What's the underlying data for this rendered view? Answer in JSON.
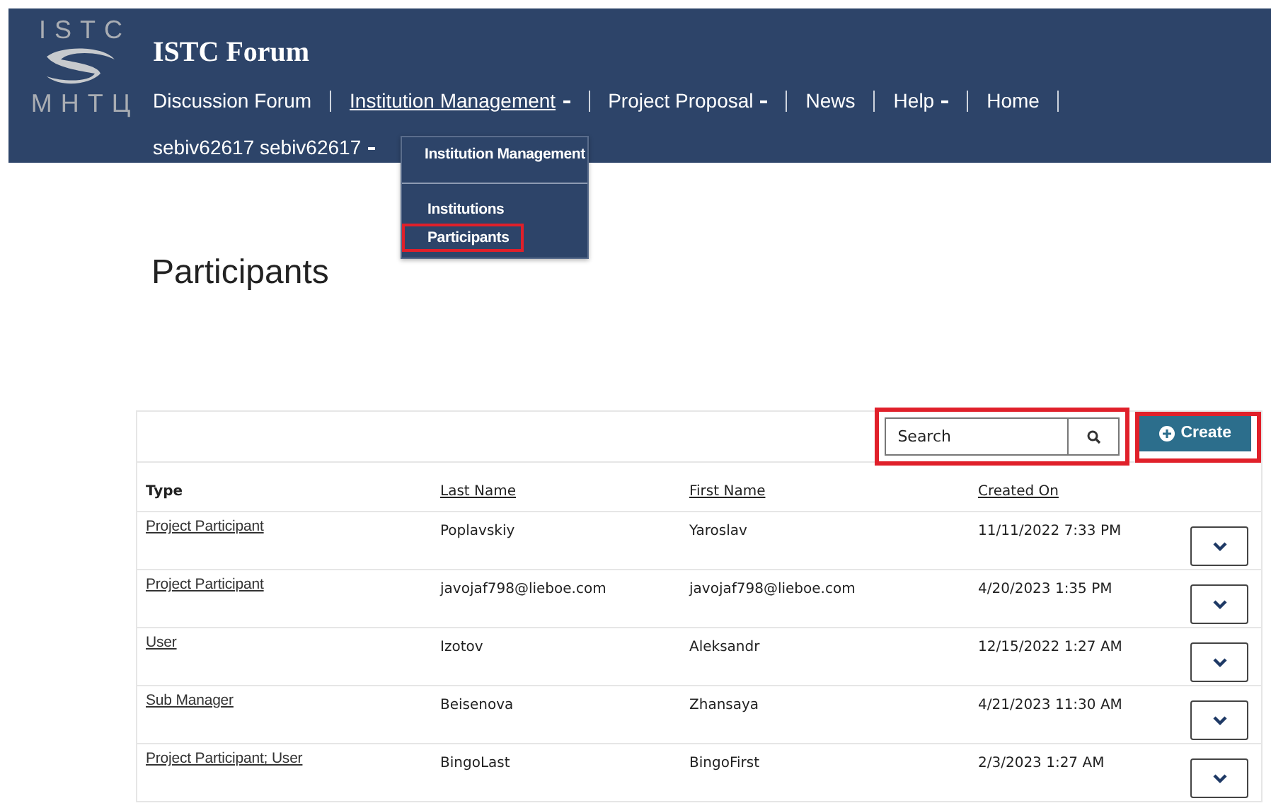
{
  "logo": {
    "top": "ISTC",
    "bottom": "МНТЦ"
  },
  "site_title": "ISTC Forum",
  "nav": [
    {
      "label": "Discussion Forum",
      "caret": false,
      "active": false
    },
    {
      "label": "Institution Management",
      "caret": true,
      "active": true
    },
    {
      "label": "Project Proposal",
      "caret": true,
      "active": false
    },
    {
      "label": "News",
      "caret": false,
      "active": false
    },
    {
      "label": "Help",
      "caret": true,
      "active": false
    },
    {
      "label": "Home",
      "caret": false,
      "active": false
    }
  ],
  "user_menu": {
    "label": "sebiv62617 sebiv62617",
    "caret": true
  },
  "dropdown": {
    "heading": "Institution Management",
    "items": [
      {
        "label": "Institutions",
        "highlighted": false
      },
      {
        "label": "Participants",
        "highlighted": true
      }
    ]
  },
  "page_title": "Participants",
  "search": {
    "placeholder": "Search",
    "highlighted": true
  },
  "create_button": {
    "label": "Create",
    "highlighted": true
  },
  "table": {
    "columns": [
      {
        "label": "Type",
        "sortable": false
      },
      {
        "label": "Last Name",
        "sortable": true
      },
      {
        "label": "First Name",
        "sortable": true
      },
      {
        "label": "Created On",
        "sortable": true
      }
    ],
    "rows": [
      {
        "type": "Project Participant",
        "last_name": "Poplavskiy",
        "first_name": "Yaroslav",
        "created_on": "11/11/2022 7:33 PM"
      },
      {
        "type": "Project Participant",
        "last_name": "javojaf798@lieboe.com",
        "first_name": "javojaf798@lieboe.com",
        "created_on": "4/20/2023 1:35 PM"
      },
      {
        "type": "User",
        "last_name": "Izotov",
        "first_name": "Aleksandr",
        "created_on": "12/15/2022 1:27 AM"
      },
      {
        "type": "Sub Manager",
        "last_name": "Beisenova",
        "first_name": "Zhansaya",
        "created_on": "4/21/2023 11:30 AM"
      },
      {
        "type": "Project Participant; User",
        "last_name": "BingoLast",
        "first_name": "BingoFirst",
        "created_on": "2/3/2023 1:27 AM"
      }
    ]
  }
}
